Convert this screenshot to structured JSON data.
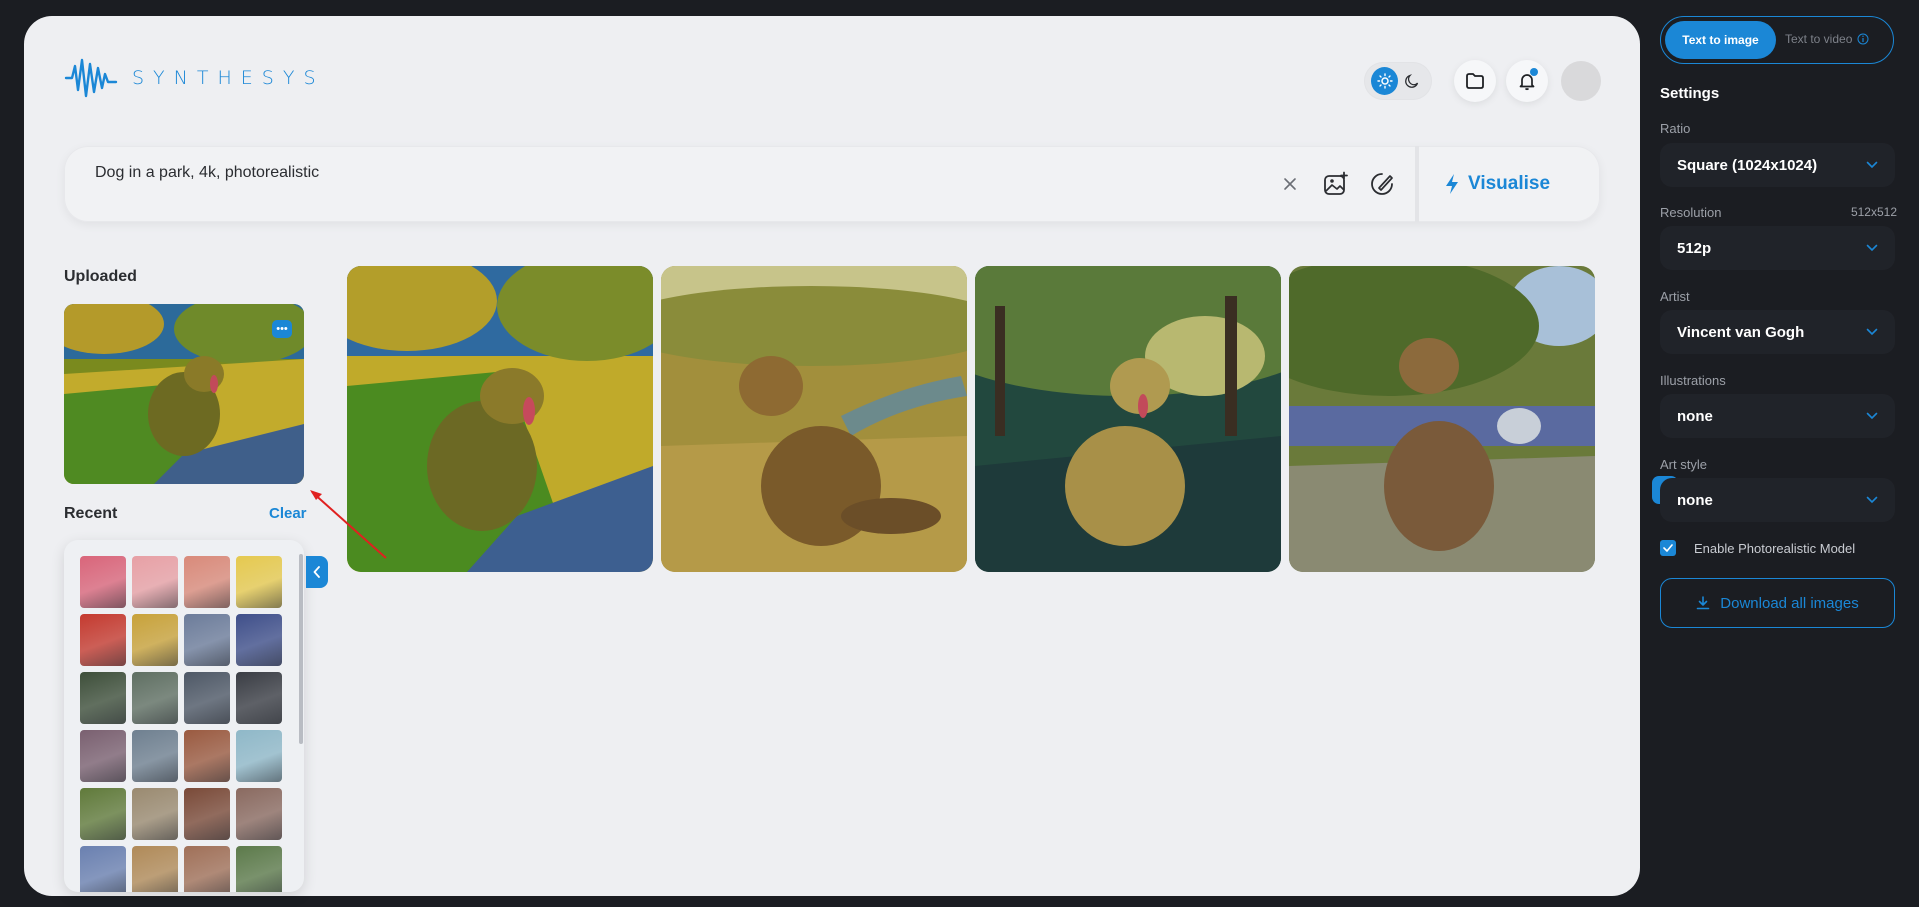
{
  "brand": {
    "name": "SYNTHESYS"
  },
  "prompt": {
    "text": "Dog in a park, 4k, photorealistic",
    "action_label": "Visualise"
  },
  "uploaded": {
    "title": "Uploaded"
  },
  "recent": {
    "title": "Recent",
    "clear_label": "Clear",
    "thumb_colors": [
      "#d9657a",
      "#e7a0a5",
      "#d98a7a",
      "#e5c94f",
      "#c43a2f",
      "#c8a23a",
      "#6c7c9a",
      "#3f4f8a",
      "#3e4f3a",
      "#5f6f62",
      "#4e5866",
      "#3a3d44",
      "#7a6070",
      "#6f8090",
      "#9a5a40",
      "#8fb8c8",
      "#607a3a",
      "#9a8a70",
      "#7a4a38",
      "#8a6a60",
      "#6a80b0",
      "#b08a58",
      "#a07058",
      "#5c7a4a"
    ]
  },
  "gallery": {
    "images": [
      {
        "name": "result-image-1"
      },
      {
        "name": "result-image-2"
      },
      {
        "name": "result-image-3"
      },
      {
        "name": "result-image-4"
      }
    ]
  },
  "sidebar": {
    "tabs": {
      "active": "Text to image",
      "inactive": "Text to video"
    },
    "settings_title": "Settings",
    "ratio": {
      "label": "Ratio",
      "value": "Square (1024x1024)"
    },
    "resolution": {
      "label": "Resolution",
      "extra": "512x512",
      "value": "512p"
    },
    "artist": {
      "label": "Artist",
      "value": "Vincent van Gogh"
    },
    "illustrations": {
      "label": "Illustrations",
      "value": "none"
    },
    "art_style": {
      "label": "Art style",
      "value": "none"
    },
    "photorealistic": {
      "label": "Enable Photorealistic Model",
      "checked": true
    },
    "download_label": "Download all images"
  },
  "colors": {
    "accent": "#1b87d6",
    "sidebar_bg": "#1b1d22",
    "canvas_bg": "#eeeff2",
    "select_bg": "#202329"
  }
}
